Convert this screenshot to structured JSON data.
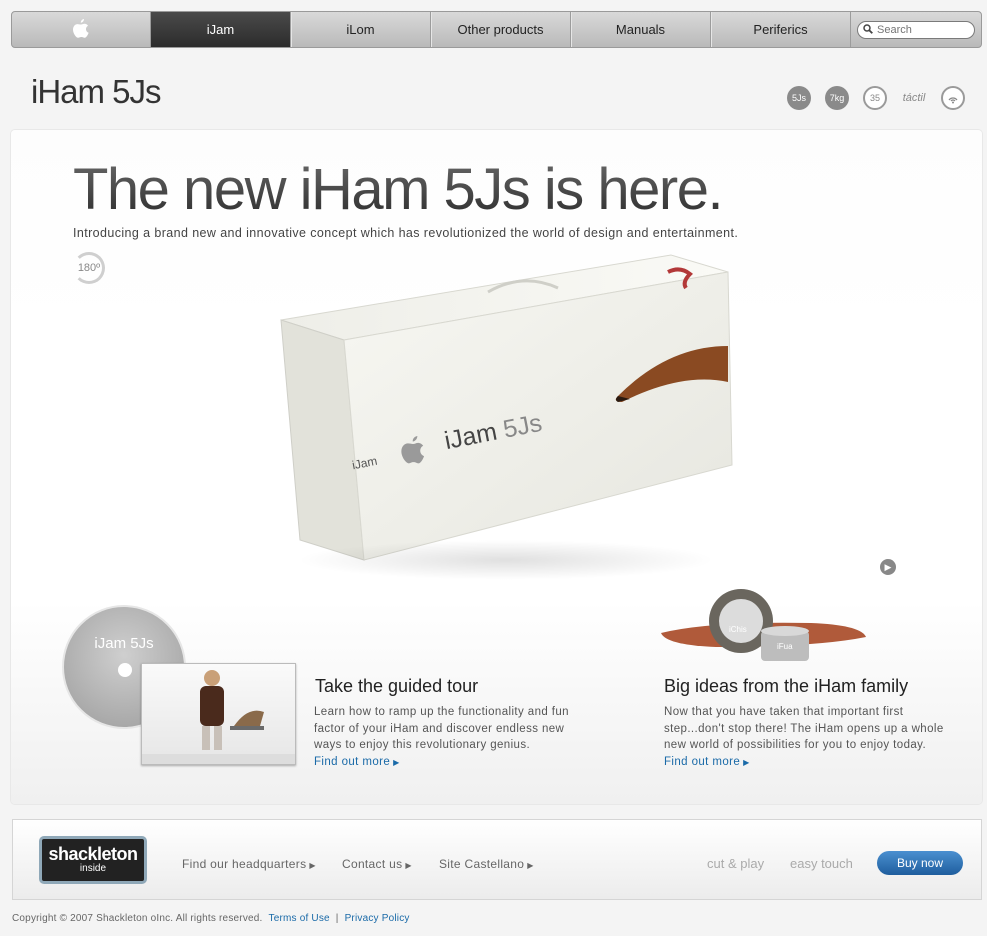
{
  "nav": {
    "items": [
      {
        "label": "iJam",
        "active": true
      },
      {
        "label": "iLom",
        "active": false
      },
      {
        "label": "Other products",
        "active": false
      },
      {
        "label": "Manuals",
        "active": false
      },
      {
        "label": "Periferics",
        "active": false
      }
    ],
    "search_placeholder": "Search"
  },
  "page": {
    "title": "iHam 5Js",
    "spec_icons": [
      "5Js",
      "7kg",
      "35",
      "táctil"
    ]
  },
  "hero": {
    "headline": "The new iHam 5Js is here.",
    "subtitle": "Introducing a brand new and innovative concept which has revolutionized the world of design and entertainment.",
    "rotate_label": "180º",
    "box_brand": "iJam",
    "box_model": "5Js",
    "box_side_label": "iJam"
  },
  "promos": [
    {
      "disc_title": "iJam 5Js",
      "title": "Take the guided tour",
      "text_lines": [
        "Learn how to ramp up the functionality and fun",
        "factor of your iHam and discover endless new",
        "ways to enjoy this revolutionary genius."
      ],
      "link": "Find out more"
    },
    {
      "title": "Big ideas from the iHam family",
      "text_lines": [
        "Now that you have taken that important first",
        "step...don't stop there! The iHam opens up a whole",
        "new world of possibilities for you to enjoy today."
      ],
      "link": "Find out more",
      "product_labels": [
        "iChis",
        "iFua"
      ]
    }
  ],
  "footer": {
    "badge_title": "shackleton",
    "badge_sub": "inside",
    "links": [
      "Find our headquarters",
      "Contact us",
      "Site Castellano"
    ],
    "brandmarks": [
      "cut & play",
      "easy touch"
    ],
    "buy_label": "Buy now",
    "copyright": "Copyright © 2007 Shackleton oInc. All rights reserved.",
    "terms": "Terms of Use",
    "separator": "|",
    "privacy": "Privacy Policy"
  },
  "colors": {
    "accent_link": "#1a6aa8",
    "nav_active": "#3a3a3a",
    "buy_button": "#2f74b8"
  }
}
